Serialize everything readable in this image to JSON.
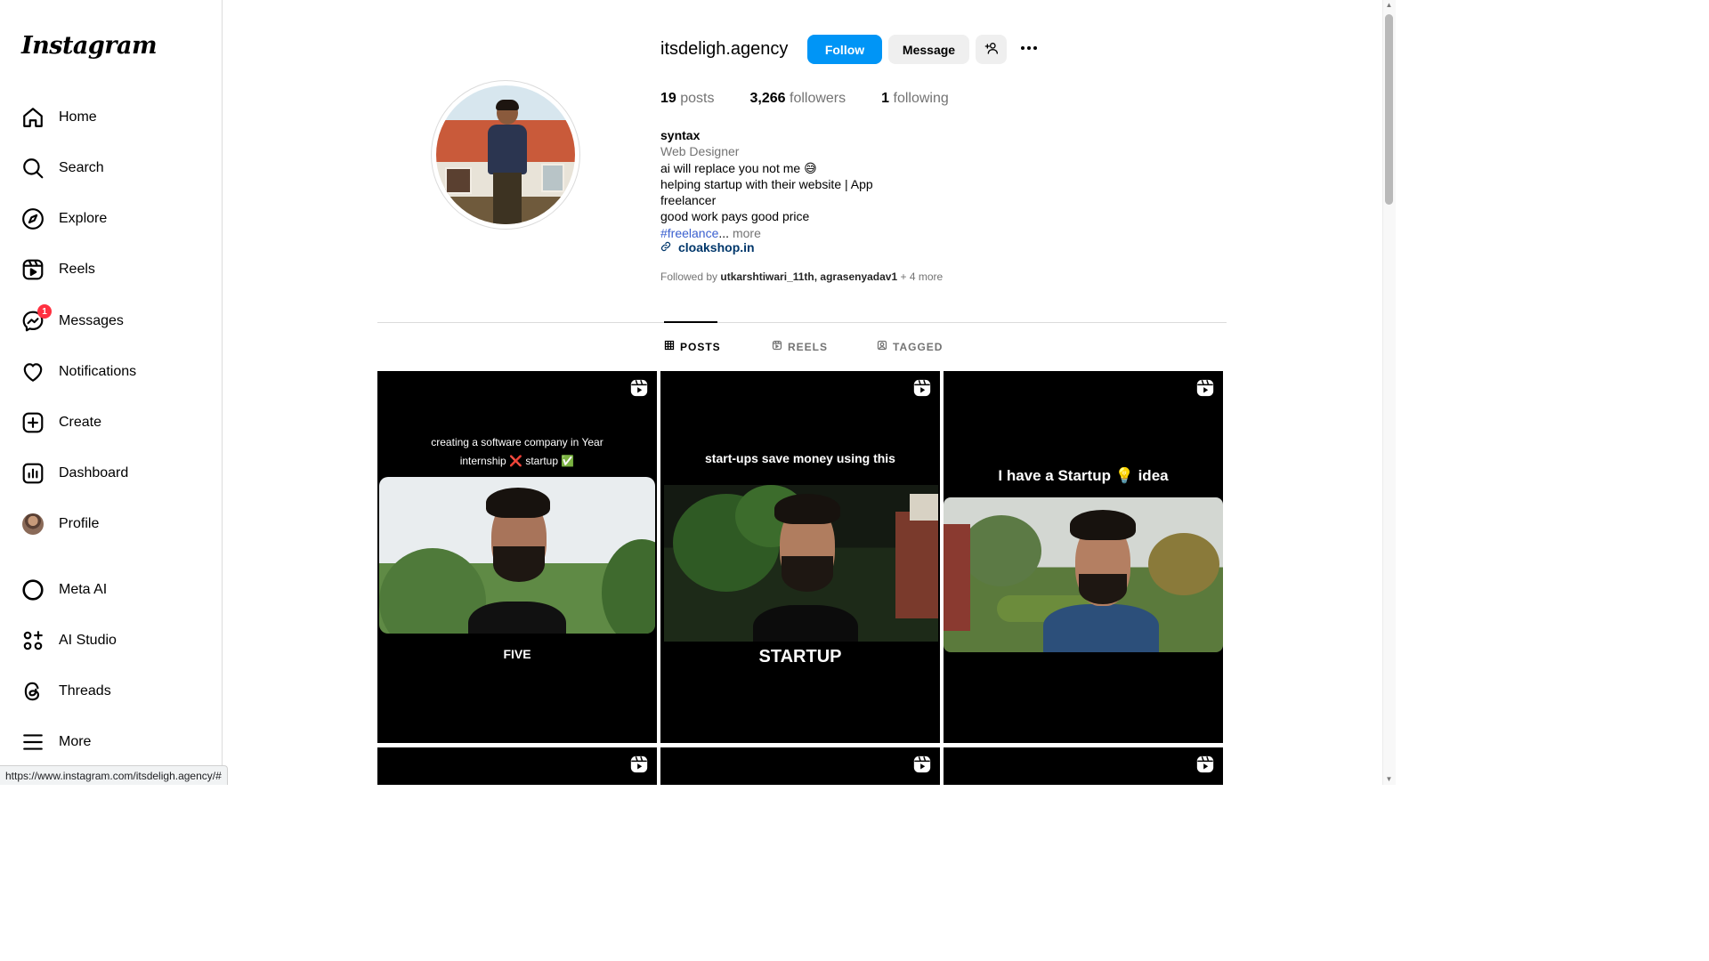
{
  "logo": "Instagram",
  "nav": [
    {
      "key": "home",
      "label": "Home",
      "icon": "home-icon"
    },
    {
      "key": "search",
      "label": "Search",
      "icon": "search-icon"
    },
    {
      "key": "explore",
      "label": "Explore",
      "icon": "compass-icon"
    },
    {
      "key": "reels",
      "label": "Reels",
      "icon": "reels-icon"
    },
    {
      "key": "messages",
      "label": "Messages",
      "icon": "messenger-icon",
      "badge": "1"
    },
    {
      "key": "notifications",
      "label": "Notifications",
      "icon": "heart-icon"
    },
    {
      "key": "create",
      "label": "Create",
      "icon": "plus-square-icon"
    },
    {
      "key": "dashboard",
      "label": "Dashboard",
      "icon": "chart-icon"
    },
    {
      "key": "profile",
      "label": "Profile",
      "icon": "avatar"
    },
    {
      "key": "meta_ai",
      "label": "Meta AI",
      "icon": "meta-ai-icon"
    },
    {
      "key": "ai_studio",
      "label": "AI Studio",
      "icon": "ai-studio-icon"
    },
    {
      "key": "threads",
      "label": "Threads",
      "icon": "threads-icon"
    },
    {
      "key": "more",
      "label": "More",
      "icon": "hamburger-icon"
    }
  ],
  "profile": {
    "username": "itsdeligh.agency",
    "follow_label": "Follow",
    "message_label": "Message",
    "stats": {
      "posts_count": "19",
      "posts_label": "posts",
      "followers_count": "3,266",
      "followers_label": "followers",
      "following_count": "1",
      "following_label": "following"
    },
    "bio": {
      "name": "syntax",
      "category": "Web Designer",
      "line1": "ai will replace you not me 😅",
      "line2": "helping startup with their website | App",
      "line3": "freelancer",
      "line4": "good work pays good price",
      "hashtag": "#freelance",
      "ellipsis": "...",
      "more": " more"
    },
    "link": "cloakshop.in",
    "followed_by_prefix": "Followed by ",
    "followed_by_users": "utkarshtiwari_11th, agrasenyadav1",
    "followed_by_more": " + 4 more"
  },
  "tabs": [
    {
      "label": "POSTS",
      "active": true
    },
    {
      "label": "REELS",
      "active": false
    },
    {
      "label": "TAGGED",
      "active": false
    }
  ],
  "posts": [
    {
      "caption_top_line1": "creating a software company in Year",
      "caption_top_line2": "internship ❌ startup ✅",
      "caption_bottom": "FIVE"
    },
    {
      "caption_top_line1": "start-ups save money using this",
      "caption_bottom": "STARTUP"
    },
    {
      "caption_top_line1": "I have a Startup 💡 idea",
      "caption_bottom": ""
    }
  ],
  "status_url": "https://www.instagram.com/itsdeligh.agency/#",
  "colors": {
    "accent": "#0095f6",
    "badge": "#ff3040",
    "link": "#00376b"
  }
}
